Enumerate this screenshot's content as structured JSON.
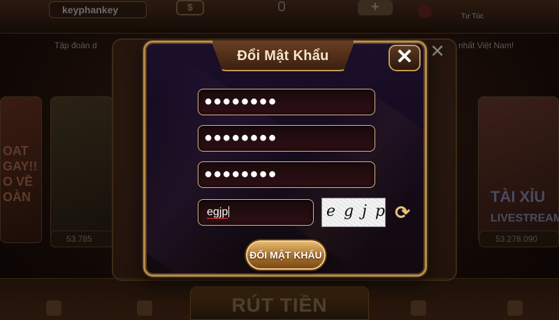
{
  "background": {
    "username": "keyphankey",
    "coin_symbol": "$",
    "plus_symbol": "+",
    "tutuc_label": "Tự Túc",
    "marquee_left": "Tập đoàn d",
    "marquee_right": "nhất Việt Nam!",
    "promo_text": "OAT GAY!! O VỀ OÀN",
    "tai_text": "TÀI XỈU",
    "live_text": "LIVESTREAM",
    "balance_left": "53.785",
    "balance_right": "53.278.090",
    "bottom_button": "RÚT TIỀN",
    "close_symbol": "✕"
  },
  "dialog": {
    "title": "Đổi Mật Khẩu",
    "close_symbol": "✕",
    "old_password_mask": "●●●●●●●●",
    "new_password_mask": "●●●●●●●●",
    "confirm_password_mask": "●●●●●●●●",
    "captcha_value": "egjp",
    "captcha_image_text": "egjp",
    "refresh_symbol": "⟳",
    "submit_label": "ĐỔI MẬT KHẨU"
  },
  "colors": {
    "accent_gold": "#c89a55",
    "dialog_bg": "#1c0f2b",
    "field_border": "#d9b98c"
  }
}
